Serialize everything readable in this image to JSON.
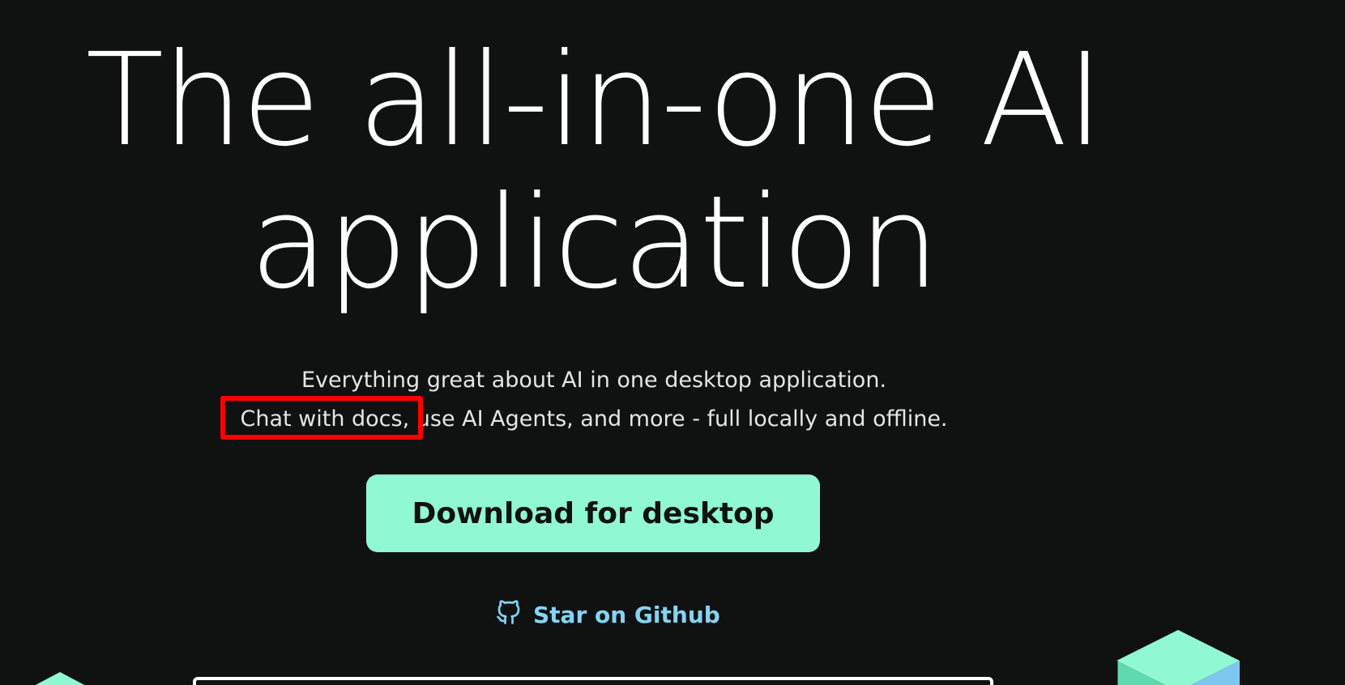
{
  "hero": {
    "title_line1": "The all-in-one AI",
    "title_line2": "application"
  },
  "subtitle": {
    "line1": "Everything great about AI in one desktop application.",
    "line2": "Chat with docs, use AI Agents, and more - full locally and offline."
  },
  "cta": {
    "download_label": "Download for desktop"
  },
  "github": {
    "label": "Star on Github",
    "icon": "github-icon"
  },
  "colors": {
    "background": "#0f1211",
    "accent": "#90f9d3",
    "link": "#84d4f5",
    "highlight": "#ff0000"
  }
}
